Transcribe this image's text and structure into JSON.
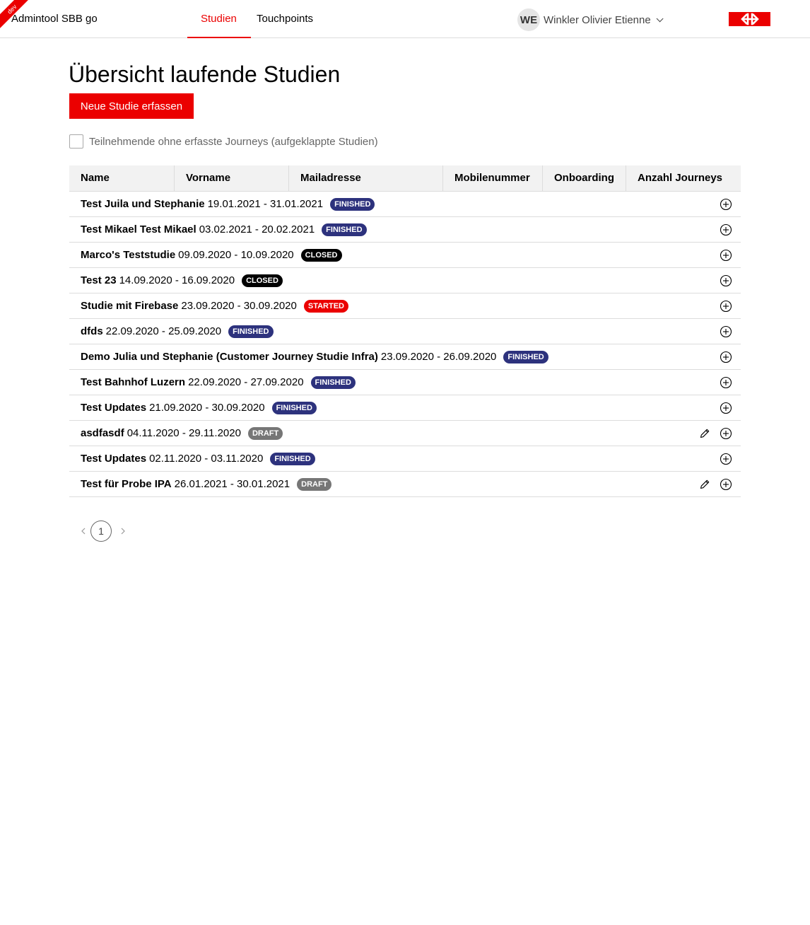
{
  "header": {
    "env_label": "dev",
    "app_title": "Admintool SBB go",
    "tabs": [
      {
        "label": "Studien",
        "active": true
      },
      {
        "label": "Touchpoints",
        "active": false
      }
    ],
    "user": {
      "initials": "WE",
      "name": "Winkler Olivier Etienne"
    },
    "accent_color": "#eb0000"
  },
  "main": {
    "title": "Übersicht laufende Studien",
    "new_button": "Neue Studie erfassen",
    "filter_label": "Teilnehmende ohne erfasste Journeys (aufgeklappte Studien)",
    "filter_checked": false
  },
  "table": {
    "columns": [
      "Name",
      "Vorname",
      "Mailadresse",
      "Mobilenummer",
      "Onboarding",
      "Anzahl Journeys"
    ],
    "rows": [
      {
        "name": "Test Juila und Stephanie",
        "dates": "19.01.2021 - 31.01.2021",
        "status": "FINISHED",
        "editable": false
      },
      {
        "name": "Test Mikael Test Mikael",
        "dates": "03.02.2021 - 20.02.2021",
        "status": "FINISHED",
        "editable": false
      },
      {
        "name": "Marco's Teststudie",
        "dates": "09.09.2020 - 10.09.2020",
        "status": "CLOSED",
        "editable": false
      },
      {
        "name": "Test 23",
        "dates": "14.09.2020 - 16.09.2020",
        "status": "CLOSED",
        "editable": false
      },
      {
        "name": "Studie mit Firebase",
        "dates": "23.09.2020 - 30.09.2020",
        "status": "STARTED",
        "editable": false
      },
      {
        "name": "dfds",
        "dates": "22.09.2020 - 25.09.2020",
        "status": "FINISHED",
        "editable": false
      },
      {
        "name": "Demo Julia und Stephanie (Customer Journey Studie Infra)",
        "dates": "23.09.2020 - 26.09.2020",
        "status": "FINISHED",
        "editable": false
      },
      {
        "name": "Test Bahnhof Luzern",
        "dates": "22.09.2020 - 27.09.2020",
        "status": "FINISHED",
        "editable": false
      },
      {
        "name": "Test Updates",
        "dates": "21.09.2020 - 30.09.2020",
        "status": "FINISHED",
        "editable": false
      },
      {
        "name": "asdfasdf",
        "dates": "04.11.2020 - 29.11.2020",
        "status": "DRAFT",
        "editable": true
      },
      {
        "name": "Test Updates",
        "dates": "02.11.2020 - 03.11.2020",
        "status": "FINISHED",
        "editable": false
      },
      {
        "name": "Test für Probe IPA",
        "dates": "26.01.2021 - 30.01.2021",
        "status": "DRAFT",
        "editable": true
      }
    ],
    "icons": {
      "expand": "plus-circle-icon",
      "edit": "pencil-icon"
    }
  },
  "pagination": {
    "current_page": "1"
  },
  "status_colors": {
    "FINISHED": "#2d327d",
    "CLOSED": "#000000",
    "STARTED": "#eb0000",
    "DRAFT": "#767676"
  }
}
